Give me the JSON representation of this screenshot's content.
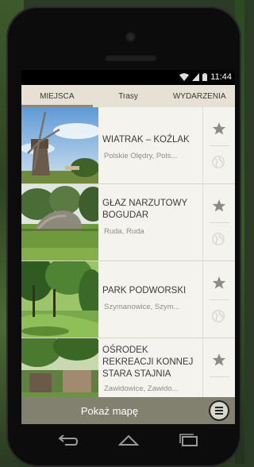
{
  "status": {
    "time": "11:44"
  },
  "tabs": [
    {
      "label": "MIEJSCA",
      "active": true
    },
    {
      "label": "Trasy",
      "active": false
    },
    {
      "label": "WYDARZENIA",
      "active": false
    }
  ],
  "places": [
    {
      "title": "WIATRAK – KOŹLAK",
      "subtitle": "Polskie Olędry, Pols..."
    },
    {
      "title": "GŁAZ NARZUTOWY BOGUDAR",
      "subtitle": "Ruda, Ruda"
    },
    {
      "title": "PARK PODWORSKI",
      "subtitle": "Szymanowice, Szym..."
    },
    {
      "title": "OŚRODEK REKREACJI KONNEJ STARA STAJNIA",
      "subtitle": "Zawidowice, Zawido..."
    }
  ],
  "bottom": {
    "map_label": "Pokaż mapę"
  },
  "icons": {
    "star": "star-icon",
    "globe": "globe-icon",
    "menu": "hamburger-menu-icon",
    "back": "back-icon",
    "home": "home-icon",
    "recents": "recent-apps-icon"
  },
  "colors": {
    "tab_bar": "#e6e1d4",
    "list_bg": "#f5f3ee",
    "bottom_bar": "#82806e",
    "icon_gray": "#8d8b86"
  }
}
